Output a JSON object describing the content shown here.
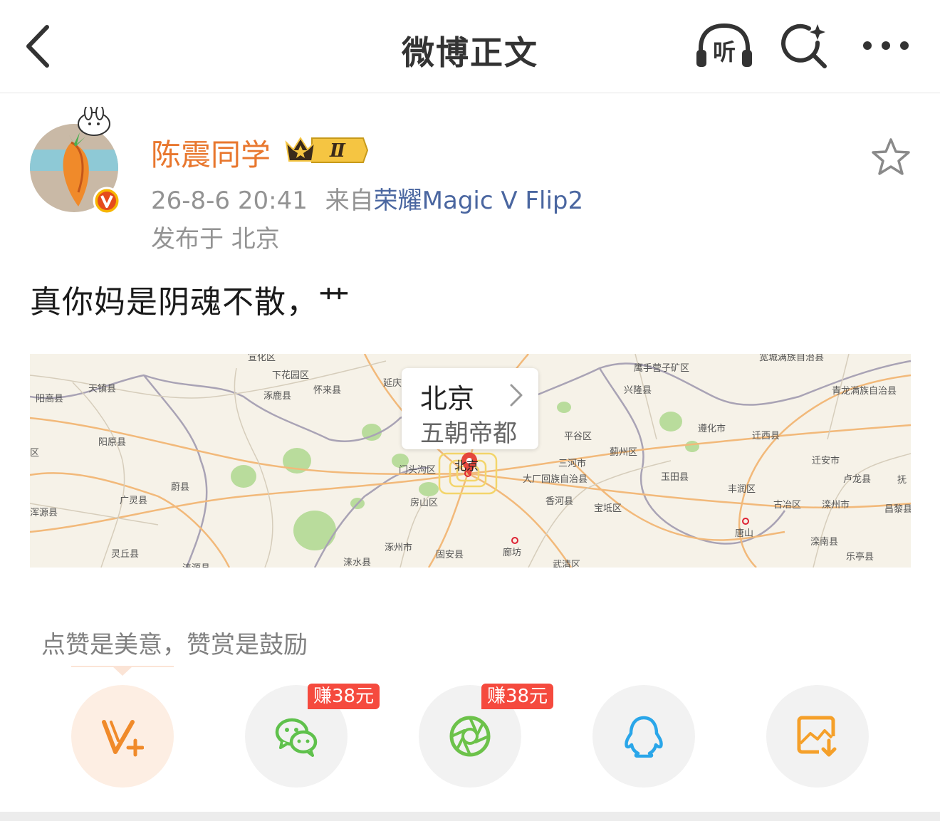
{
  "nav": {
    "title": "微博正文",
    "listen_label": "听"
  },
  "post": {
    "author": "陈震同学",
    "member_level": "Ⅱ",
    "time": "26-8-6 20:41",
    "source_prefix": "来自",
    "source": "荣耀Magic V Flip2",
    "location": "发布于 北京",
    "text": "真你妈是阴魂不散，艹"
  },
  "map": {
    "city": "北京",
    "description": "五朝帝都",
    "pin_label": "北京",
    "labels": [
      "宣化区",
      "下花园区",
      "怀来县",
      "延庆区",
      "鹰手营子矿区",
      "宽城满族自治县",
      "阳高县",
      "天镇县",
      "涿鹿县",
      "兴隆县",
      "青龙满族自治县",
      "阳原县",
      "平谷区",
      "遵化市",
      "迁西县",
      "区",
      "蓟州区",
      "迁安市",
      "门头沟区",
      "三河市",
      "大厂回族自治县",
      "玉田县",
      "卢龙县",
      "蔚县",
      "广灵县",
      "房山区",
      "香河县",
      "宝坻区",
      "丰润区",
      "古冶区",
      "滦州市",
      "昌黎县",
      "浑源县",
      "唐山",
      "涿州市",
      "廊坊",
      "滦南县",
      "灵丘县",
      "涞源县",
      "涞水县",
      "固安县",
      "武清区",
      "乐亭县",
      "抚"
    ]
  },
  "reward_hint": "点赞是美意，赞赏是鼓励",
  "share": {
    "earn_badge_1": "赚38元",
    "earn_badge_2": "赚38元"
  },
  "colors": {
    "accent_orange": "#e8772e",
    "source_blue": "#4a66a0",
    "earn_red": "#f54a3e",
    "wechat_green": "#5fc14c",
    "moments_green": "#6cc24a",
    "qq_blue": "#2aa6e9",
    "save_orange": "#f5a02a"
  }
}
